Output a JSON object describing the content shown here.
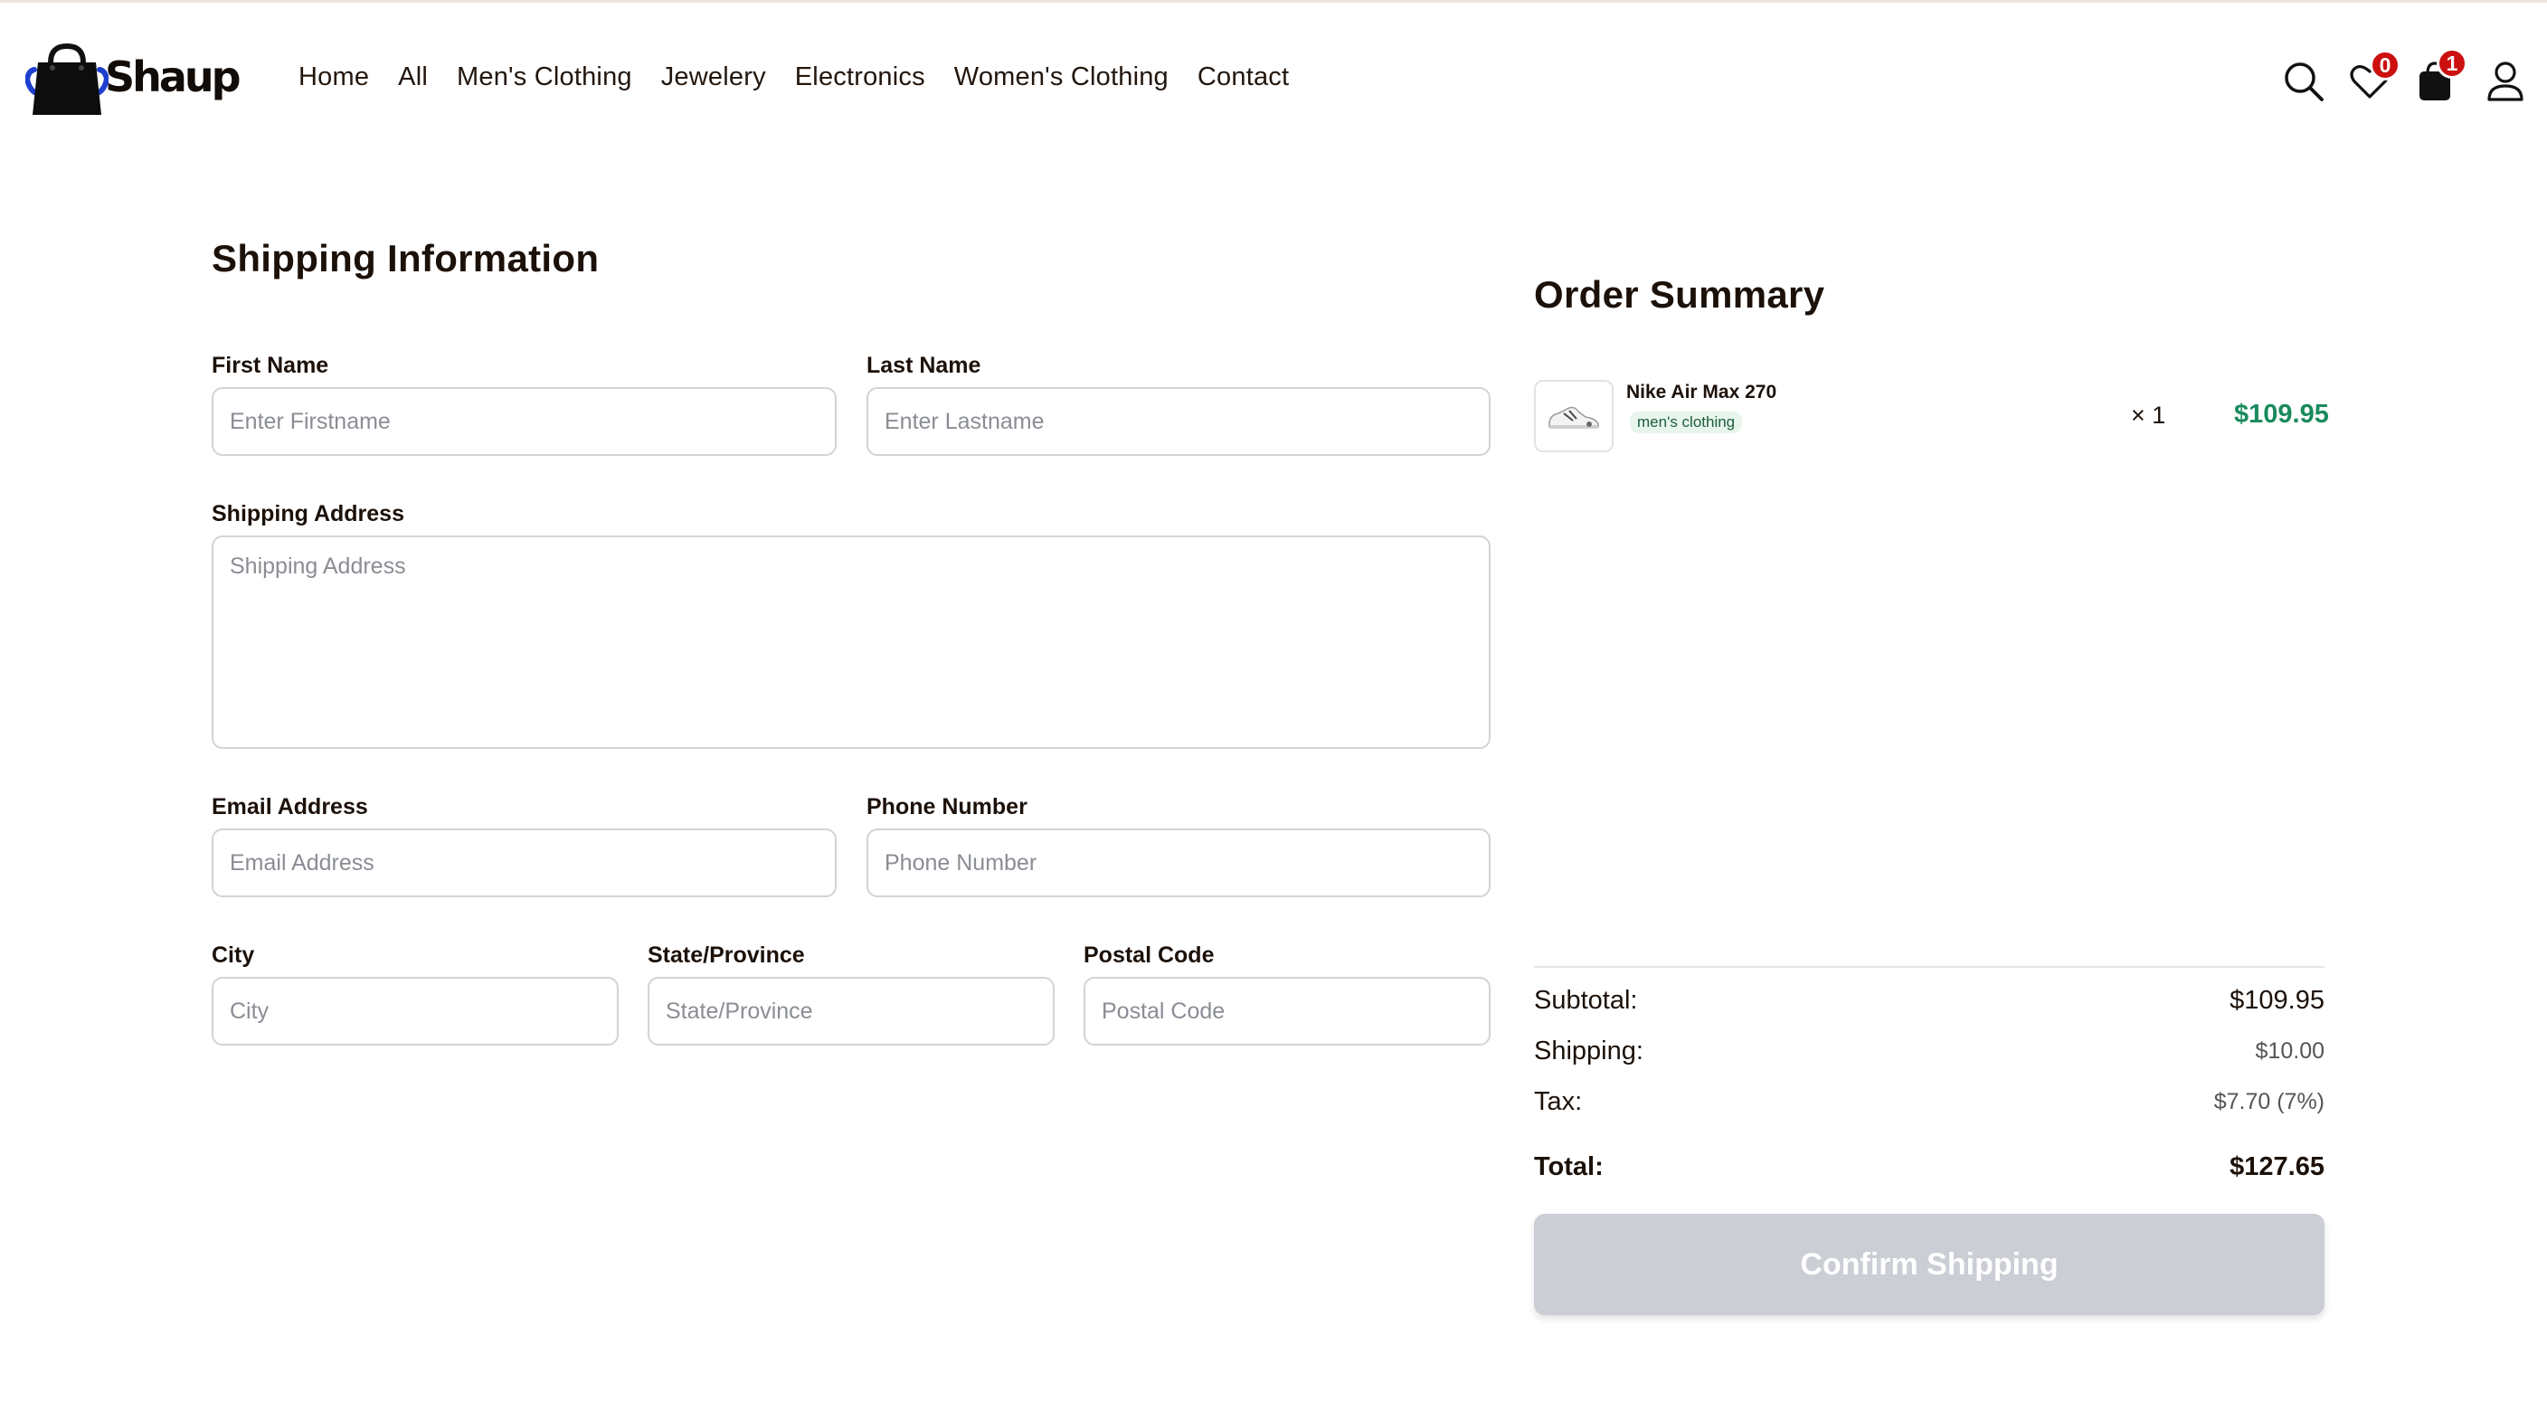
{
  "brand": {
    "name": "Shaup"
  },
  "nav": {
    "items": [
      {
        "label": "Home"
      },
      {
        "label": "All"
      },
      {
        "label": "Men's Clothing"
      },
      {
        "label": "Jewelery"
      },
      {
        "label": "Electronics"
      },
      {
        "label": "Women's Clothing"
      },
      {
        "label": "Contact"
      }
    ],
    "wishlist_count": "0",
    "cart_count": "1",
    "icons": [
      "search-icon",
      "heart-icon",
      "shopping-bag-icon",
      "user-icon"
    ]
  },
  "shipping": {
    "title": "Shipping Information",
    "first_name": {
      "label": "First Name",
      "placeholder": "Enter Firstname",
      "value": ""
    },
    "last_name": {
      "label": "Last Name",
      "placeholder": "Enter Lastname",
      "value": ""
    },
    "address": {
      "label": "Shipping Address",
      "placeholder": "Shipping Address",
      "value": ""
    },
    "email": {
      "label": "Email Address",
      "placeholder": "Email Address",
      "value": ""
    },
    "phone": {
      "label": "Phone Number",
      "placeholder": "Phone Number",
      "value": ""
    },
    "city": {
      "label": "City",
      "placeholder": "City",
      "value": ""
    },
    "state": {
      "label": "State/Province",
      "placeholder": "State/Province",
      "value": ""
    },
    "postal": {
      "label": "Postal Code",
      "placeholder": "Postal Code",
      "value": ""
    }
  },
  "summary": {
    "title": "Order Summary",
    "items": [
      {
        "name": "Nike Air Max 270",
        "category": "men's clothing",
        "quantity": "× 1",
        "price": "$109.95"
      }
    ],
    "subtotal_label": "Subtotal:",
    "subtotal": "$109.95",
    "shipping_label": "Shipping:",
    "shipping": "$10.00",
    "tax_label": "Tax:",
    "tax": "$7.70 (7%)",
    "total_label": "Total:",
    "total": "$127.65",
    "confirm_label": "Confirm Shipping"
  },
  "colors": {
    "price_accent": "#1a8a5c",
    "badge": "#cc1010",
    "button_disabled": "#cbced4",
    "brand_blue": "#1f3fcf"
  }
}
